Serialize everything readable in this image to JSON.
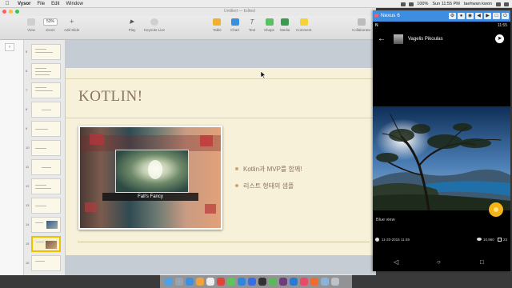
{
  "menubar": {
    "apple": "",
    "items": [
      "Vysor",
      "File",
      "Edit",
      "Window"
    ],
    "clock": "Sun 11:55 PM",
    "user": "taehwan kwon",
    "battery": "100%"
  },
  "keynote": {
    "doc_title": "Untitled — Edited",
    "toolbar": {
      "view": "View",
      "zoom_value": "53%",
      "zoom": "Zoom",
      "add_slide": "Add Slide",
      "play": "Play",
      "keynote_live": "Keynote Live",
      "table": "Table",
      "chart": "Chart",
      "text": "Text",
      "shape": "Shape",
      "media": "Media",
      "comment": "Comment",
      "collaborate": "Collaborate"
    },
    "slide_numbers": [
      "5",
      "6",
      "7",
      "8",
      "9",
      "10",
      "11",
      "12",
      "13",
      "14",
      "15",
      "16"
    ],
    "selected_slide": "15",
    "slide": {
      "title": "KOTLIN!",
      "photo_caption": "Fall's Fancy",
      "bullets": [
        "Kotlin과 MVP를 함께!",
        "리스트 형태의 샘플"
      ]
    }
  },
  "phone": {
    "window_title": "Nexus 6",
    "status_right": "11:55",
    "user_name": "Vagelis Pikoulas",
    "photo_label": "Blue view",
    "date": "11-20-2016 11:49",
    "views": "10,960",
    "comments": "23",
    "nav": {
      "back": "◁",
      "home": "○",
      "recent": "□"
    }
  },
  "colors": {
    "accent_blue": "#3d8de0",
    "slide_bg": "#f7f1d9",
    "title_brown": "#8b7560",
    "fab": "#f5b31a"
  }
}
